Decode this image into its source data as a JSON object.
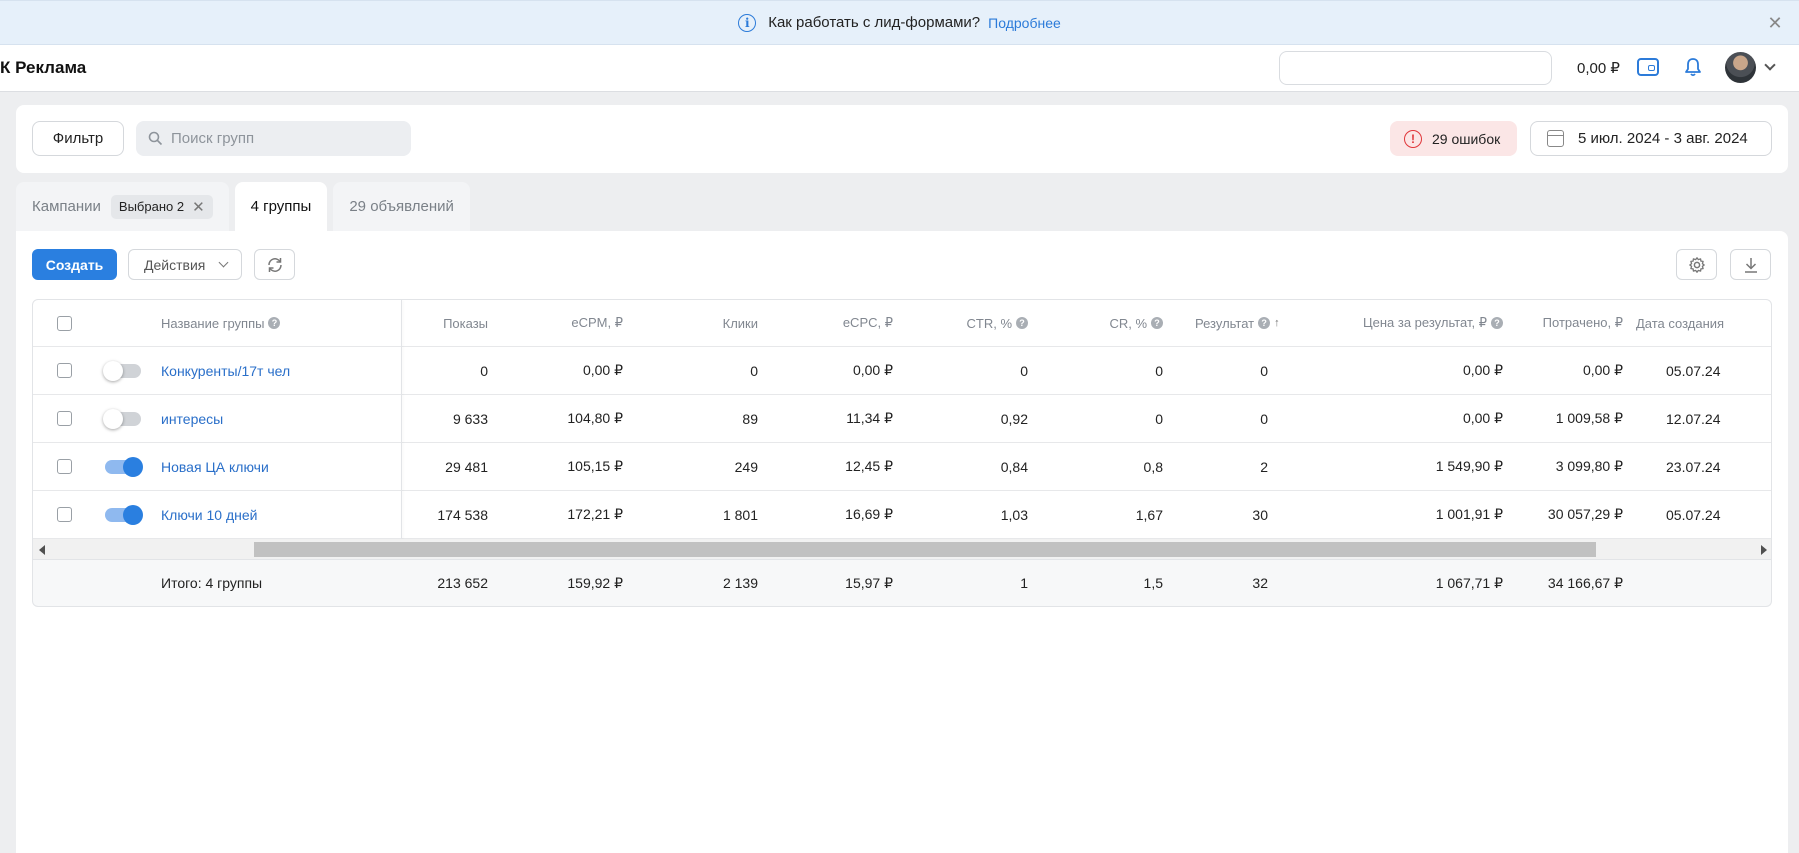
{
  "banner": {
    "text": "Как работать с лид-формами?",
    "link": "Подробнее"
  },
  "header": {
    "logo": "К Реклама",
    "balance": "0,00 ₽"
  },
  "filter": {
    "filter_button": "Фильтр",
    "search_placeholder": "Поиск групп",
    "errors": "29 ошибок",
    "date_range": "5 июл. 2024 - 3 авг. 2024"
  },
  "tabs": {
    "campaigns": "Кампании",
    "selected_chip": "Выбрано 2",
    "groups": "4 группы",
    "ads": "29 объявлений"
  },
  "toolbar": {
    "create": "Создать",
    "actions": "Действия"
  },
  "table": {
    "columns": {
      "name": "Название группы",
      "shows": "Показы",
      "ecpm": "eCPM, ₽",
      "clicks": "Клики",
      "ecpc": "eCPC, ₽",
      "ctr": "CTR, %",
      "cr": "CR, %",
      "result": "Результат",
      "price": "Цена за результат, ₽",
      "spent": "Потрачено, ₽",
      "created": "Дата создания"
    },
    "rows": [
      {
        "name": "Конкуренты/17т чел",
        "active": false,
        "shows": "0",
        "ecpm": "0,00 ₽",
        "clicks": "0",
        "ecpc": "0,00 ₽",
        "ctr": "0",
        "cr": "0",
        "result": "0",
        "price": "0,00 ₽",
        "spent": "0,00 ₽",
        "created": "05.07.24"
      },
      {
        "name": "интересы",
        "active": false,
        "shows": "9 633",
        "ecpm": "104,80 ₽",
        "clicks": "89",
        "ecpc": "11,34 ₽",
        "ctr": "0,92",
        "cr": "0",
        "result": "0",
        "price": "0,00 ₽",
        "spent": "1 009,58 ₽",
        "created": "12.07.24"
      },
      {
        "name": "Новая ЦА ключи",
        "active": true,
        "shows": "29 481",
        "ecpm": "105,15 ₽",
        "clicks": "249",
        "ecpc": "12,45 ₽",
        "ctr": "0,84",
        "cr": "0,8",
        "result": "2",
        "price": "1 549,90 ₽",
        "spent": "3 099,80 ₽",
        "created": "23.07.24"
      },
      {
        "name": "Ключи 10 дней",
        "active": true,
        "shows": "174 538",
        "ecpm": "172,21 ₽",
        "clicks": "1 801",
        "ecpc": "16,69 ₽",
        "ctr": "1,03",
        "cr": "1,67",
        "result": "30",
        "price": "1 001,91 ₽",
        "spent": "30 057,29 ₽",
        "created": "05.07.24"
      }
    ],
    "totals": {
      "label": "Итого: 4 группы",
      "shows": "213 652",
      "ecpm": "159,92 ₽",
      "clicks": "2 139",
      "ecpc": "15,97 ₽",
      "ctr": "1",
      "cr": "1,5",
      "result": "32",
      "price": "1 067,71 ₽",
      "spent": "34 166,67 ₽"
    }
  }
}
